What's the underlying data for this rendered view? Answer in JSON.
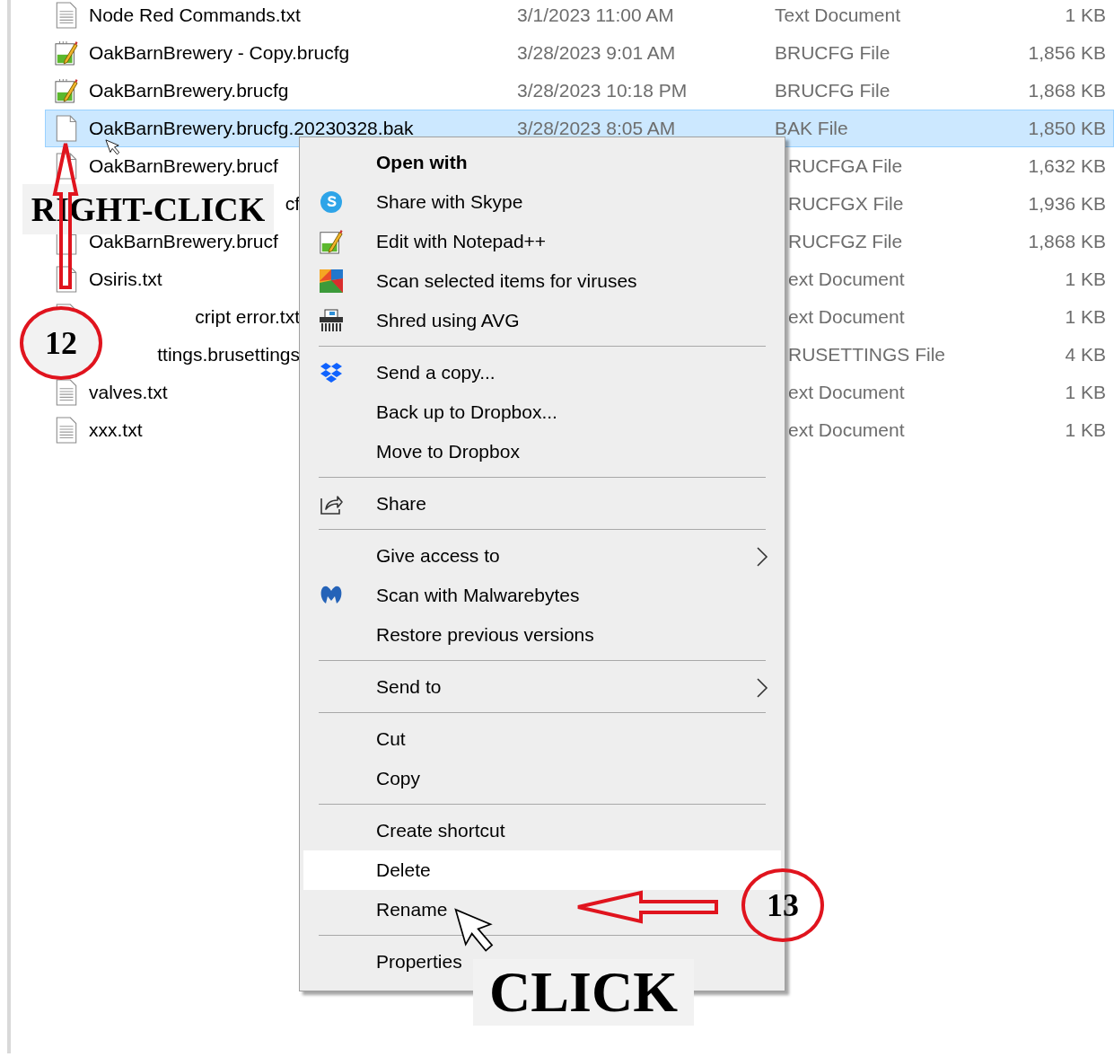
{
  "files": [
    {
      "kind": "text",
      "name": "Node Red Commands.txt",
      "date": "3/1/2023 11:00 AM",
      "type": "Text Document",
      "size": "1 KB",
      "selected": false
    },
    {
      "kind": "notepad",
      "name": "OakBarnBrewery - Copy.brucfg",
      "date": "3/28/2023 9:01 AM",
      "type": "BRUCFG File",
      "size": "1,856 KB",
      "selected": false
    },
    {
      "kind": "notepad",
      "name": "OakBarnBrewery.brucfg",
      "date": "3/28/2023 10:18 PM",
      "type": "BRUCFG File",
      "size": "1,868 KB",
      "selected": false
    },
    {
      "kind": "blank",
      "name": "OakBarnBrewery.brucfg.20230328.bak",
      "date": "3/28/2023 8:05 AM",
      "type": "BAK File",
      "size": "1,850 KB",
      "selected": true
    },
    {
      "kind": "blank",
      "name": "OakBarnBrewery.brucf",
      "type": "RUCFGA File",
      "size": "1,632 KB",
      "selected": false
    },
    {
      "kind": "plain",
      "name": "cf",
      "covered": true,
      "type": "RUCFGX File",
      "size": "1,936 KB",
      "selected": false
    },
    {
      "kind": "blank",
      "name": "OakBarnBrewery.brucf",
      "type": "RUCFGZ File",
      "size": "1,868 KB",
      "selected": false
    },
    {
      "kind": "blank",
      "name": "Osiris.txt",
      "type": "ext Document",
      "size": "1 KB",
      "selected": false
    },
    {
      "kind": "text",
      "name": "cript error.txt",
      "covered": true,
      "type": "ext Document",
      "size": "1 KB",
      "selected": false
    },
    {
      "kind": "plain",
      "name": "ttings.brusettings",
      "covered": true,
      "type": "RUSETTINGS File",
      "size": "4 KB",
      "selected": false
    },
    {
      "kind": "text",
      "name": "valves.txt",
      "type": "ext Document",
      "size": "1 KB",
      "selected": false
    },
    {
      "kind": "text",
      "name": "xxx.txt",
      "type": "ext Document",
      "size": "1 KB",
      "selected": false
    }
  ],
  "context_menu": {
    "items": [
      {
        "kind": "plain",
        "label": "Open with",
        "default": true,
        "submenu": false,
        "selected": false
      },
      {
        "kind": "skype",
        "label": "Share with Skype",
        "default": false,
        "submenu": false,
        "selected": false
      },
      {
        "kind": "notepad",
        "label": "Edit with Notepad++",
        "default": false,
        "submenu": false,
        "selected": false
      },
      {
        "kind": "avg",
        "label": "Scan selected items for viruses",
        "default": false,
        "submenu": false,
        "selected": false
      },
      {
        "kind": "shredder",
        "label": "Shred using AVG",
        "default": false,
        "submenu": false,
        "selected": false
      },
      {
        "kind": "separator"
      },
      {
        "kind": "dropbox",
        "label": "Send a copy...",
        "default": false,
        "submenu": false,
        "selected": false
      },
      {
        "kind": "plain",
        "label": "Back up to Dropbox...",
        "default": false,
        "submenu": false,
        "selected": false
      },
      {
        "kind": "plain",
        "label": "Move to Dropbox",
        "default": false,
        "submenu": false,
        "selected": false
      },
      {
        "kind": "separator"
      },
      {
        "kind": "share",
        "label": "Share",
        "default": false,
        "submenu": false,
        "selected": false
      },
      {
        "kind": "separator"
      },
      {
        "kind": "plain",
        "label": "Give access to",
        "default": false,
        "submenu": true,
        "selected": false
      },
      {
        "kind": "malwarebytes",
        "label": "Scan with Malwarebytes",
        "default": false,
        "submenu": false,
        "selected": false
      },
      {
        "kind": "plain",
        "label": "Restore previous versions",
        "default": false,
        "submenu": false,
        "selected": false
      },
      {
        "kind": "separator"
      },
      {
        "kind": "plain",
        "label": "Send to",
        "default": false,
        "submenu": true,
        "selected": false
      },
      {
        "kind": "separator"
      },
      {
        "kind": "plain",
        "label": "Cut",
        "default": false,
        "submenu": false,
        "selected": false
      },
      {
        "kind": "plain",
        "label": "Copy",
        "default": false,
        "submenu": false,
        "selected": false
      },
      {
        "kind": "separator"
      },
      {
        "kind": "plain",
        "label": "Create shortcut",
        "default": false,
        "submenu": false,
        "selected": false
      },
      {
        "kind": "plain",
        "label": "Delete",
        "default": false,
        "submenu": false,
        "selected": true
      },
      {
        "kind": "plain",
        "label": "Rename",
        "default": false,
        "submenu": false,
        "selected": false
      },
      {
        "kind": "separator"
      },
      {
        "kind": "plain",
        "label": "Properties",
        "default": false,
        "submenu": false,
        "selected": false
      }
    ]
  },
  "annotations": {
    "right_click_label": "RIGHT-CLICK",
    "click_label": "CLICK",
    "steps": [
      "12",
      "13"
    ]
  }
}
